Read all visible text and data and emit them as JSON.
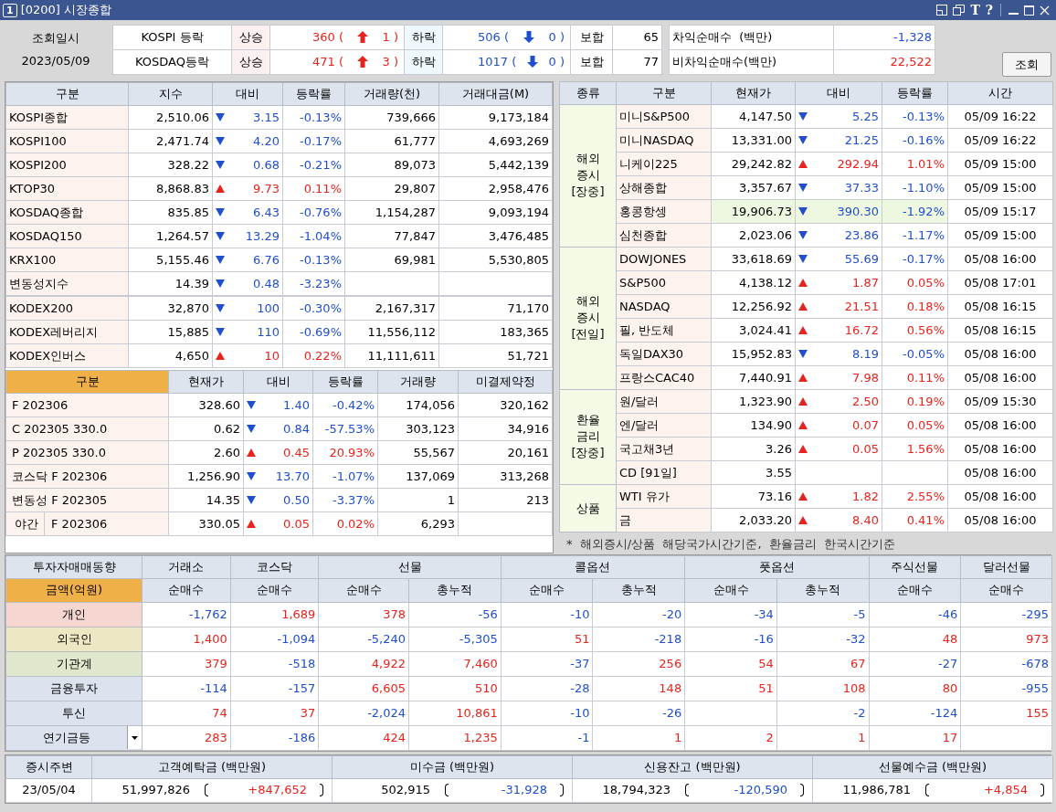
{
  "window": {
    "number": "1",
    "title": "[0200] 시장종합",
    "tool_labels": [
      "T",
      "?"
    ]
  },
  "query": {
    "label": "조회일시",
    "date": "2023/05/09",
    "button": "조회"
  },
  "breadth": [
    {
      "name": "KOSPI 등락",
      "up_label": "상승",
      "up": "360 (",
      "up_limit": "1 )",
      "down_label": "하락",
      "down": "506 (",
      "down_limit": "0 )",
      "flat_label": "보합",
      "flat": "65"
    },
    {
      "name": "KOSDAQ등락",
      "up_label": "상승",
      "up": "471 (",
      "up_limit": "3 )",
      "down_label": "하락",
      "down": "1017 (",
      "down_limit": "0 )",
      "flat_label": "보합",
      "flat": "77"
    }
  ],
  "program": [
    {
      "label": "차익순매수  (백만)",
      "value": "-1,328"
    },
    {
      "label": "비차익순매수(백만)",
      "value": "22,522"
    }
  ],
  "domestic": {
    "columns": [
      "구분",
      "지수",
      "대비",
      "등락률",
      "거래량(천)",
      "거래대금(M)"
    ],
    "index_rows": [
      {
        "name": "KOSPI종합",
        "price": "2,510.06",
        "rising": false,
        "change": "3.15",
        "rate": "-0.13%",
        "volume": "739,666",
        "amount": "9,173,184"
      },
      {
        "name": "KOSPI100",
        "price": "2,471.74",
        "rising": false,
        "change": "4.20",
        "rate": "-0.17%",
        "volume": "61,777",
        "amount": "4,693,269"
      },
      {
        "name": "KOSPI200",
        "price": "328.22",
        "rising": false,
        "change": "0.68",
        "rate": "-0.21%",
        "volume": "89,073",
        "amount": "5,442,139"
      },
      {
        "name": "KTOP30",
        "price": "8,868.83",
        "rising": true,
        "change": "9.73",
        "rate": "0.11%",
        "volume": "29,807",
        "amount": "2,958,476"
      },
      {
        "name": "KOSDAQ종합",
        "price": "835.85",
        "rising": false,
        "change": "6.43",
        "rate": "-0.76%",
        "volume": "1,154,287",
        "amount": "9,093,194"
      },
      {
        "name": "KOSDAQ150",
        "price": "1,264.57",
        "rising": false,
        "change": "13.29",
        "rate": "-1.04%",
        "volume": "77,847",
        "amount": "3,476,485"
      },
      {
        "name": "KRX100",
        "price": "5,155.46",
        "rising": false,
        "change": "6.76",
        "rate": "-0.13%",
        "volume": "69,981",
        "amount": "5,530,805"
      },
      {
        "name": "변동성지수",
        "price": "14.39",
        "rising": false,
        "change": "0.48",
        "rate": "-3.23%"
      }
    ],
    "etf_rows": [
      {
        "name": "KODEX200",
        "price": "32,870",
        "rising": false,
        "change": "100",
        "rate": "-0.30%",
        "volume": "2,167,317",
        "amount": "71,170"
      },
      {
        "name": "KODEX레버리지",
        "price": "15,885",
        "rising": false,
        "change": "110",
        "rate": "-0.69%",
        "volume": "11,556,112",
        "amount": "183,365"
      },
      {
        "name": "KODEX인버스",
        "price": "4,650",
        "rising": true,
        "change": "10",
        "rate": "0.22%",
        "volume": "11,111,611",
        "amount": "51,721"
      }
    ]
  },
  "futures": {
    "columns": [
      "구분",
      "현재가",
      "대비",
      "등락률",
      "거래량",
      "미결제약정"
    ],
    "rows": [
      {
        "name": "F 202306",
        "price": "328.60",
        "rising": false,
        "change": "1.40",
        "rate": "-0.42%",
        "volume": "174,056",
        "open_interest": "320,162"
      },
      {
        "name": "C 202305 330.0",
        "price": "0.62",
        "rising": false,
        "change": "0.84",
        "rate": "-57.53%",
        "volume": "303,123",
        "open_interest": "34,916"
      },
      {
        "name": "P 202305 330.0",
        "price": "2.60",
        "rising": true,
        "change": "0.45",
        "rate": "20.93%",
        "volume": "55,567",
        "open_interest": "20,161"
      },
      {
        "name": "코스닥 F 202306",
        "price": "1,256.90",
        "rising": false,
        "change": "13.70",
        "rate": "-1.07%",
        "volume": "137,069",
        "open_interest": "313,268"
      },
      {
        "name": "변동성 F 202305",
        "price": "14.35",
        "rising": false,
        "change": "0.50",
        "rate": "-3.37%",
        "volume": "1",
        "open_interest": "213"
      },
      {
        "tag": "야간",
        "name": "F 202306",
        "price": "330.05",
        "rising": true,
        "change": "0.05",
        "rate": "0.02%",
        "volume": "6,293"
      }
    ]
  },
  "overseas": {
    "columns": [
      "종류",
      "구분",
      "현재가",
      "대비",
      "등락률",
      "시간"
    ],
    "groups": [
      {
        "label_lines": [
          "해외",
          "증시",
          "[장중]"
        ],
        "rows": [
          {
            "name": "미니S&P500",
            "price": "4,147.50",
            "rising": false,
            "change": "5.25",
            "rate": "-0.13%",
            "time": "05/09 16:22",
            "highlighted": false
          },
          {
            "name": "미니NASDAQ",
            "price": "13,331.00",
            "rising": false,
            "change": "21.25",
            "rate": "-0.16%",
            "time": "05/09 16:22",
            "highlighted": false
          },
          {
            "name": "니케이225",
            "price": "29,242.82",
            "rising": true,
            "change": "292.94",
            "rate": "1.01%",
            "time": "05/09 15:00",
            "highlighted": false
          },
          {
            "name": "상해종합",
            "price": "3,357.67",
            "rising": false,
            "change": "37.33",
            "rate": "-1.10%",
            "time": "05/09 15:00",
            "highlighted": false
          },
          {
            "name": "홍콩항셍",
            "price": "19,906.73",
            "rising": false,
            "change": "390.30",
            "rate": "-1.92%",
            "time": "05/09 15:17",
            "highlighted": true
          },
          {
            "name": "심천종합",
            "price": "2,023.06",
            "rising": false,
            "change": "23.86",
            "rate": "-1.17%",
            "time": "05/09 15:00",
            "highlighted": false
          }
        ]
      },
      {
        "label_lines": [
          "해외",
          "증시",
          "[전일]"
        ],
        "rows": [
          {
            "name": "DOWJONES",
            "price": "33,618.69",
            "rising": false,
            "change": "55.69",
            "rate": "-0.17%",
            "time": "05/08 16:00",
            "highlighted": false
          },
          {
            "name": "S&P500",
            "price": "4,138.12",
            "rising": true,
            "change": "1.87",
            "rate": "0.05%",
            "time": "05/08 17:01",
            "highlighted": false
          },
          {
            "name": "NASDAQ",
            "price": "12,256.92",
            "rising": true,
            "change": "21.51",
            "rate": "0.18%",
            "time": "05/08 16:15",
            "highlighted": false
          },
          {
            "name": "필, 반도체",
            "price": "3,024.41",
            "rising": true,
            "change": "16.72",
            "rate": "0.56%",
            "time": "05/08 16:15",
            "highlighted": false
          },
          {
            "name": "독일DAX30",
            "price": "15,952.83",
            "rising": false,
            "change": "8.19",
            "rate": "-0.05%",
            "time": "05/08 16:00",
            "highlighted": false
          },
          {
            "name": "프랑스CAC40",
            "price": "7,440.91",
            "rising": true,
            "change": "7.98",
            "rate": "0.11%",
            "time": "05/08 16:00",
            "highlighted": false
          }
        ]
      },
      {
        "label_lines": [
          "환율",
          "금리",
          "[장중]"
        ],
        "rows": [
          {
            "name": "원/달러",
            "price": "1,323.90",
            "rising": true,
            "change": "2.50",
            "rate": "0.19%",
            "time": "05/09 15:30",
            "highlighted": false
          },
          {
            "name": "엔/달러",
            "price": "134.90",
            "rising": true,
            "change": "0.07",
            "rate": "0.05%",
            "time": "05/08 16:00",
            "highlighted": false
          },
          {
            "name": "국고채3년",
            "price": "3.26",
            "rising": true,
            "change": "0.05",
            "rate": "1.56%",
            "time": "05/08 16:00",
            "highlighted": false
          },
          {
            "name": "CD [91일]",
            "price": "3.55",
            "time": "05/08 16:00",
            "highlighted": false
          }
        ]
      },
      {
        "label_lines": [
          "상품"
        ],
        "rows": [
          {
            "name": "WTI 유가",
            "price": "73.16",
            "rising": true,
            "change": "1.82",
            "rate": "2.55%",
            "time": "05/08 16:00",
            "highlighted": false
          },
          {
            "name": "금",
            "price": "2,033.20",
            "rising": true,
            "change": "8.40",
            "rate": "0.41%",
            "time": "05/08 16:00",
            "highlighted": false
          }
        ]
      }
    ],
    "note": "*  해외증시/상품  해당국가시간기준,  환율금리  한국시간기준"
  },
  "investors": {
    "title": "투자자매매동향",
    "unit": "금액(억원)",
    "groups": [
      {
        "label": "거래소",
        "subs": [
          "순매수"
        ]
      },
      {
        "label": "코스닥",
        "subs": [
          "순매수"
        ]
      },
      {
        "label": "선물",
        "subs": [
          "순매수",
          "총누적"
        ]
      },
      {
        "label": "콜옵션",
        "subs": [
          "순매수",
          "총누적"
        ]
      },
      {
        "label": "풋옵션",
        "subs": [
          "순매수",
          "총누적"
        ]
      },
      {
        "label": "주식선물",
        "subs": [
          "순매수"
        ]
      },
      {
        "label": "달러선물",
        "subs": [
          "순매수"
        ]
      }
    ],
    "rows": [
      {
        "name": "개인",
        "color": "#f5d6d0",
        "kind": "label",
        "values": {
          "exchange": "-1,762",
          "kosdaq": "1,689",
          "futures_net": "378",
          "futures_total": "-56",
          "call_net": "-10",
          "call_total": "-20",
          "put_net": "-34",
          "put_total": "-5",
          "stock_futures_net": "-46",
          "dollar_futures_net": "-295"
        }
      },
      {
        "name": "외국인",
        "color": "#eee7c4",
        "kind": "label",
        "values": {
          "exchange": "1,400",
          "kosdaq": "-1,094",
          "futures_net": "-5,240",
          "futures_total": "-5,305",
          "call_net": "51",
          "call_total": "-218",
          "put_net": "-16",
          "put_total": "-32",
          "stock_futures_net": "48",
          "dollar_futures_net": "973"
        }
      },
      {
        "name": "기관계",
        "color": "#dfe8cd",
        "kind": "label",
        "values": {
          "exchange": "379",
          "kosdaq": "-518",
          "futures_net": "4,922",
          "futures_total": "7,460",
          "call_net": "-37",
          "call_total": "256",
          "put_net": "54",
          "put_total": "67",
          "stock_futures_net": "-27",
          "dollar_futures_net": "-678"
        }
      },
      {
        "name": "금융투자",
        "color": "#dce3ee",
        "kind": "label",
        "values": {
          "exchange": "-114",
          "kosdaq": "-157",
          "futures_net": "6,605",
          "futures_total": "510",
          "call_net": "-28",
          "call_total": "148",
          "put_net": "51",
          "put_total": "108",
          "stock_futures_net": "80",
          "dollar_futures_net": "-955"
        }
      },
      {
        "name": "투신",
        "color": "#dce3ee",
        "kind": "label",
        "values": {
          "exchange": "74",
          "kosdaq": "37",
          "futures_net": "-2,024",
          "futures_total": "10,861",
          "call_net": "-10",
          "call_total": "-26",
          "put_total": "-2",
          "stock_futures_net": "-124",
          "dollar_futures_net": "155"
        }
      },
      {
        "name": "연기금등",
        "color": "#dce3ee",
        "kind": "dropdown",
        "values": {
          "exchange": "283",
          "kosdaq": "-186",
          "futures_net": "424",
          "futures_total": "1,235",
          "call_net": "-1",
          "call_total": "1",
          "put_net": "2",
          "put_total": "1",
          "stock_futures_net": "17"
        }
      }
    ]
  },
  "funds": {
    "date_label": "증시주변",
    "date": "23/05/04",
    "items": [
      {
        "label": "고객예탁금 (백만원)",
        "value": "51,997,826",
        "change": "+847,652"
      },
      {
        "label": "미수금 (백만원)",
        "value": "502,915",
        "change": "-31,928"
      },
      {
        "label": "신용잔고 (백만원)",
        "value": "18,794,323",
        "change": "-120,590"
      },
      {
        "label": "선물예수금 (백만원)",
        "value": "11,986,781",
        "change": "+4,854"
      }
    ]
  }
}
